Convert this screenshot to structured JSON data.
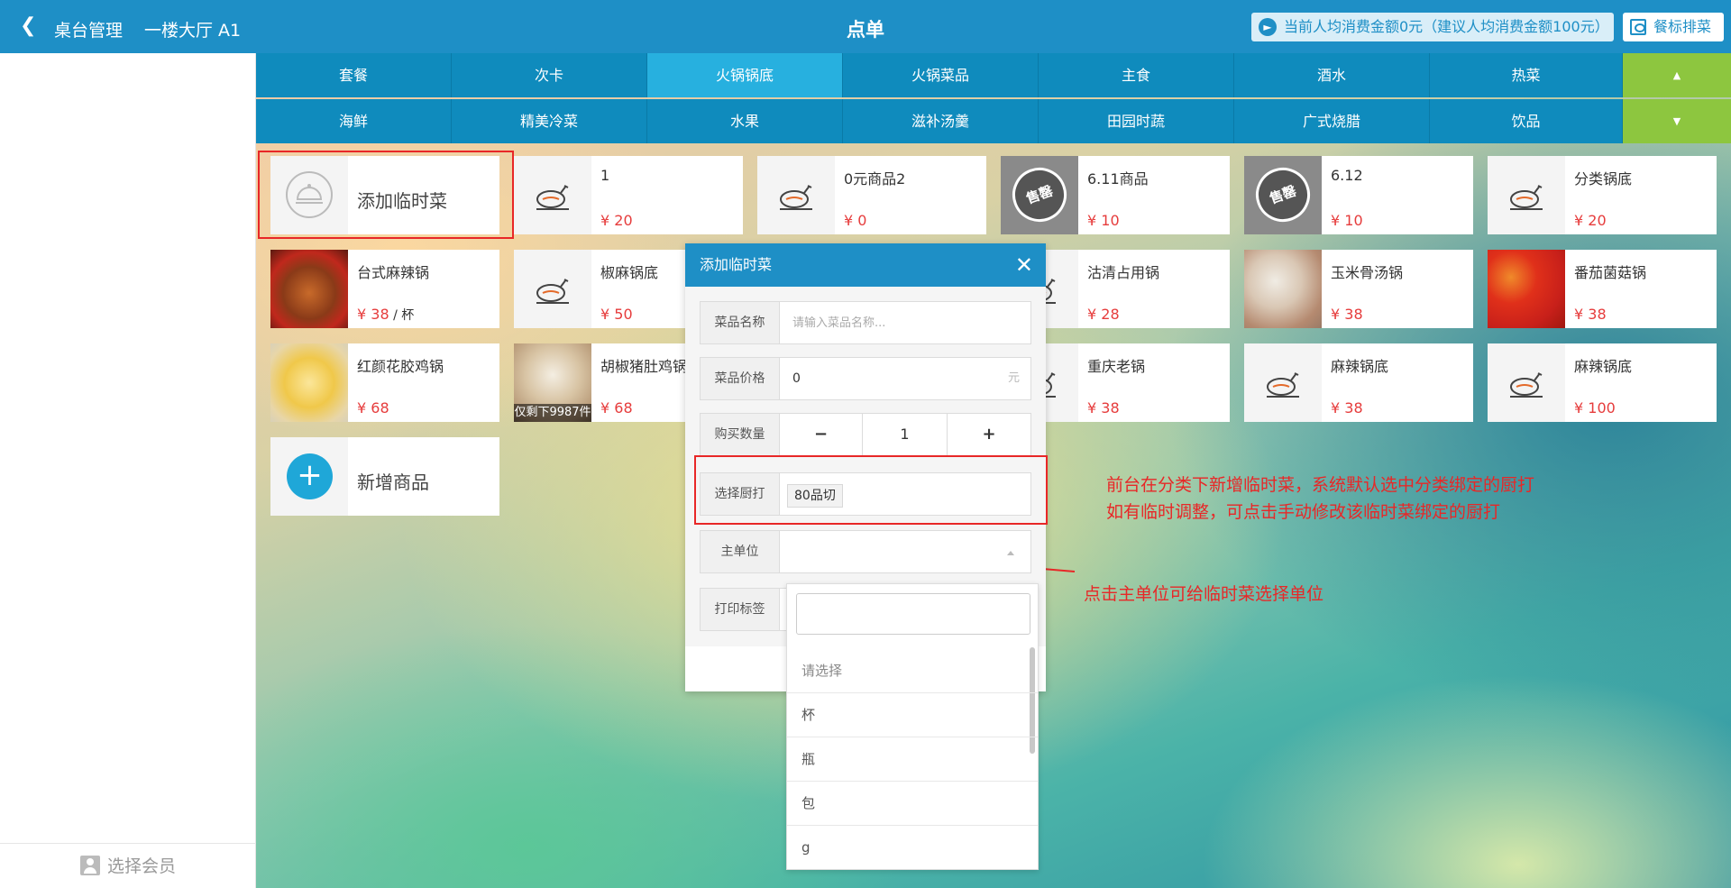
{
  "header": {
    "back_label": "桌台管理",
    "table_label": "一楼大厅 A1",
    "title": "点单",
    "notice": "当前人均消费金额0元（建议人均消费金额100元）",
    "rank_button": "餐标排菜"
  },
  "sidebar": {
    "member_label": "选择会员"
  },
  "tabs": {
    "row1": [
      "套餐",
      "次卡",
      "火锅锅底",
      "火锅菜品",
      "主食",
      "酒水",
      "热菜"
    ],
    "row2": [
      "海鲜",
      "精美冷菜",
      "水果",
      "滋补汤羹",
      "田园时蔬",
      "广式烧腊",
      "饮品"
    ],
    "active": "火锅锅底",
    "up_arrow": "▲",
    "down_arrow": "▼"
  },
  "products": {
    "add_temp": "添加临时菜",
    "add_new": "新增商品",
    "items": [
      {
        "name": "1",
        "price": "¥ 20"
      },
      {
        "name": "0元商品2",
        "price": "¥ 0"
      },
      {
        "name": "6.11商品",
        "price": "¥ 10"
      },
      {
        "name": "6.12",
        "price": "¥ 10"
      },
      {
        "name": "分类锅底",
        "price": "¥ 20"
      },
      {
        "name": "台式麻辣锅",
        "price": "¥ 38",
        "unit": " / 杯"
      },
      {
        "name": "椒麻锅底",
        "price": "¥ 50"
      },
      {
        "name": "沽清占用锅",
        "price": "¥ 28"
      },
      {
        "name": "玉米骨汤锅",
        "price": "¥ 38"
      },
      {
        "name": "番茄菌菇锅",
        "price": "¥ 38"
      },
      {
        "name": "红颜花胶鸡锅",
        "price": "¥ 68"
      },
      {
        "name": "胡椒猪肚鸡锅",
        "price": "¥ 68"
      },
      {
        "name": "重庆老锅",
        "price": "¥ 38"
      },
      {
        "name": "麻辣锅底",
        "price": "¥ 38"
      },
      {
        "name": "麻辣锅底",
        "price": "¥ 100"
      }
    ],
    "soldout_label": "售罄",
    "remain_label": "仅剩下9987件"
  },
  "modal": {
    "title": "添加临时菜",
    "close": "✕",
    "name_label": "菜品名称",
    "name_placeholder": "请输入菜品名称...",
    "price_label": "菜品价格",
    "price_value": "0",
    "price_suffix": "元",
    "qty_label": "购买数量",
    "qty_minus": "−",
    "qty_value": "1",
    "qty_plus": "+",
    "printer_label": "选择厨打",
    "printer_value": "80品切",
    "unit_label": "主单位",
    "tag_label": "打印标签"
  },
  "dropdown": {
    "search_value": "",
    "options": [
      "请选择",
      "杯",
      "瓶",
      "包",
      "g"
    ]
  },
  "annotations": {
    "line1": "前台在分类下新增临时菜，系统默认选中分类绑定的厨打",
    "line2": "如有临时调整，可点击手动修改该临时菜绑定的厨打",
    "line3": "点击主单位可给临时菜选择单位"
  },
  "colors": {
    "primary": "#1e8fc6",
    "active_tab": "#27b0df",
    "arrow_green": "#8dc63f",
    "price_red": "#e63c3c",
    "annotation_red": "#e82727"
  }
}
